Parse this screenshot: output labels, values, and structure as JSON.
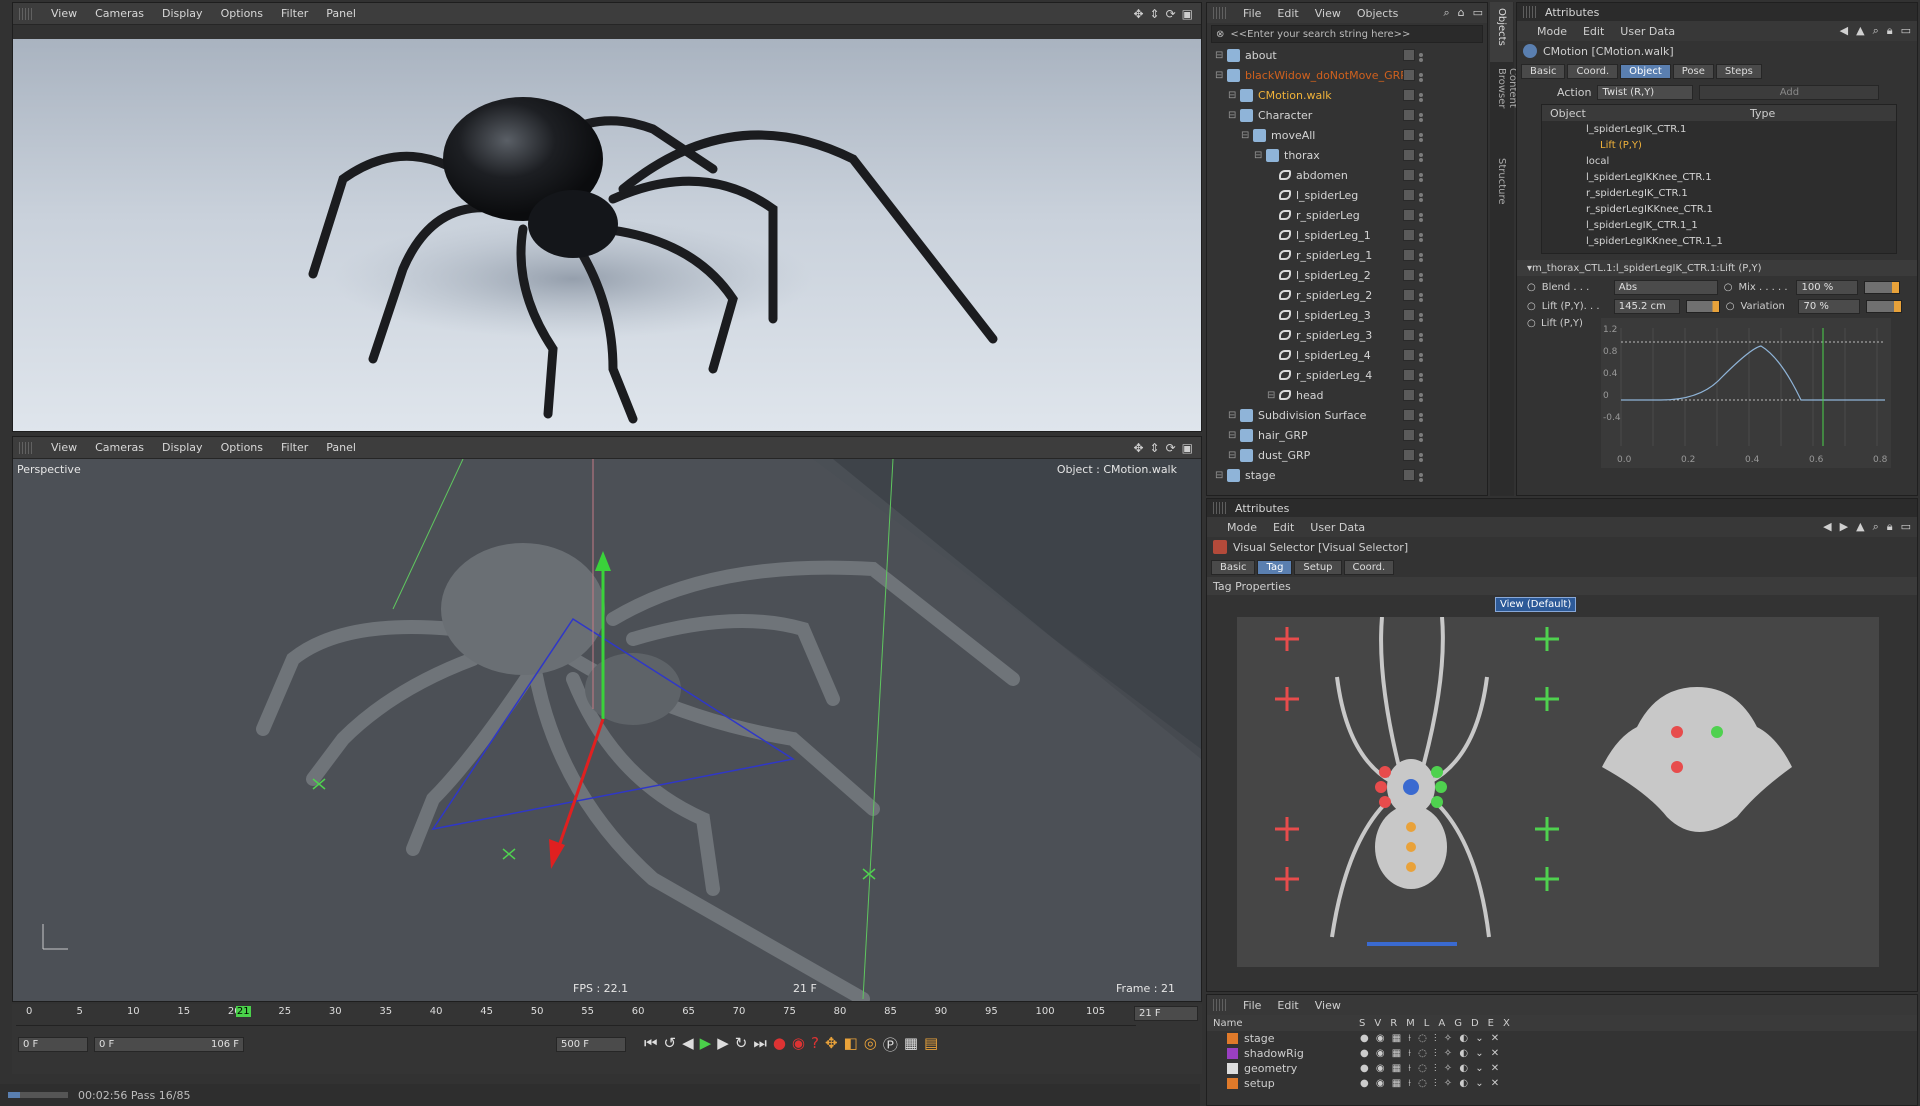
{
  "viewport_top": {
    "menu": [
      "View",
      "Cameras",
      "Display",
      "Options",
      "Filter",
      "Panel"
    ]
  },
  "viewport_bottom": {
    "menu": [
      "View",
      "Cameras",
      "Display",
      "Options",
      "Filter",
      "Panel"
    ],
    "camera_label": "Perspective",
    "object_label": "Object : CMotion.walk",
    "fps": "FPS : 22.1",
    "frame_mid": "21 F",
    "frame_right": "Frame : 21"
  },
  "timeline": {
    "ticks": [
      "0",
      "5",
      "10",
      "15",
      "20",
      "25",
      "30",
      "35",
      "40",
      "45",
      "50",
      "55",
      "60",
      "65",
      "70",
      "75",
      "80",
      "85",
      "90",
      "95",
      "100",
      "105"
    ],
    "current": "21",
    "current_frame": "21 F",
    "start": "0 F",
    "range_start": "0 F",
    "range_end": "106 F",
    "end": "500 F",
    "playhead_fraction": 0.198
  },
  "status": {
    "text": "00:02:56 Pass 16/85"
  },
  "object_manager": {
    "menu": [
      "File",
      "Edit",
      "View",
      "Objects"
    ],
    "search_placeholder": "<<Enter your search string here>>",
    "items": [
      {
        "label": "about",
        "depth": 0
      },
      {
        "label": "blackWidow_doNotMove_GRP",
        "depth": 0,
        "color": "#d0611e"
      },
      {
        "label": "CMotion.walk",
        "depth": 1,
        "color": "#f0b23a"
      },
      {
        "label": "Character",
        "depth": 1
      },
      {
        "label": "moveAll",
        "depth": 2
      },
      {
        "label": "thorax",
        "depth": 3
      },
      {
        "label": "abdomen",
        "depth": 4
      },
      {
        "label": "l_spiderLeg",
        "depth": 4
      },
      {
        "label": "r_spiderLeg",
        "depth": 4
      },
      {
        "label": "l_spiderLeg_1",
        "depth": 4
      },
      {
        "label": "r_spiderLeg_1",
        "depth": 4
      },
      {
        "label": "l_spiderLeg_2",
        "depth": 4
      },
      {
        "label": "r_spiderLeg_2",
        "depth": 4
      },
      {
        "label": "l_spiderLeg_3",
        "depth": 4
      },
      {
        "label": "r_spiderLeg_3",
        "depth": 4
      },
      {
        "label": "l_spiderLeg_4",
        "depth": 4
      },
      {
        "label": "r_spiderLeg_4",
        "depth": 4
      },
      {
        "label": "head",
        "depth": 4
      },
      {
        "label": "Subdivision Surface",
        "depth": 1
      },
      {
        "label": "hair_GRP",
        "depth": 1
      },
      {
        "label": "dust_GRP",
        "depth": 1
      },
      {
        "label": "stage",
        "depth": 0
      }
    ]
  },
  "side_tabs": [
    "Objects",
    "Content Browser",
    "Structure"
  ],
  "attributes_top": {
    "title": "Attributes",
    "menu": [
      "Mode",
      "Edit",
      "User Data"
    ],
    "object_name": "CMotion [CMotion.walk]",
    "tabs": [
      "Basic",
      "Coord.",
      "Object",
      "Pose",
      "Steps"
    ],
    "active_tab": "Object",
    "action_label": "Action",
    "action_value": "Twist (R,Y)",
    "add_label": "Add",
    "col_object": "Object",
    "col_type": "Type",
    "list": [
      {
        "label": "l_spiderLegIK_CTR.1"
      },
      {
        "label": "Lift (P,Y)",
        "highlight": true
      },
      {
        "label": "local"
      },
      {
        "label": "l_spiderLegIKKnee_CTR.1"
      },
      {
        "label": "r_spiderLegIK_CTR.1"
      },
      {
        "label": "r_spiderLegIKKnee_CTR.1"
      },
      {
        "label": "l_spiderLegIK_CTR.1_1"
      },
      {
        "label": "l_spiderLegIKKnee_CTR.1_1"
      }
    ],
    "section_title": "m_thorax_CTL.1:l_spiderLegIK_CTR.1:Lift (P,Y)",
    "blend_label": "Blend . . .",
    "blend_value": "Abs",
    "mix_label": "Mix . . . . .",
    "mix_value": "100 %",
    "lift_label": "Lift (P,Y). . .",
    "lift_value": "145.2 cm",
    "variation_label": "Variation",
    "variation_value": "70 %",
    "curve_label": "Lift (P,Y)",
    "curve_x_ticks": [
      "0.0",
      "0.2",
      "0.4",
      "0.6",
      "0.8"
    ],
    "curve_y_ticks": [
      "1.2",
      "0.8",
      "0.4",
      "0",
      "-0.4"
    ]
  },
  "attributes_bottom": {
    "title": "Attributes",
    "menu": [
      "Mode",
      "Edit",
      "User Data"
    ],
    "object_name": "Visual Selector [Visual Selector]",
    "tabs": [
      "Basic",
      "Tag",
      "Setup",
      "Coord."
    ],
    "active_tab": "Tag",
    "section": "Tag Properties",
    "view_label": "View (Default)"
  },
  "layers": {
    "menu": [
      "File",
      "Edit",
      "View"
    ],
    "name_header": "Name",
    "flag_headers": [
      "S",
      "V",
      "R",
      "M",
      "L",
      "A",
      "G",
      "D",
      "E",
      "X"
    ],
    "rows": [
      {
        "label": "stage",
        "color": "#e07a2a"
      },
      {
        "label": "shadowRig",
        "color": "#9a3fc2"
      },
      {
        "label": "geometry",
        "color": "#dddddd"
      },
      {
        "label": "setup",
        "color": "#e07a2a"
      }
    ]
  }
}
